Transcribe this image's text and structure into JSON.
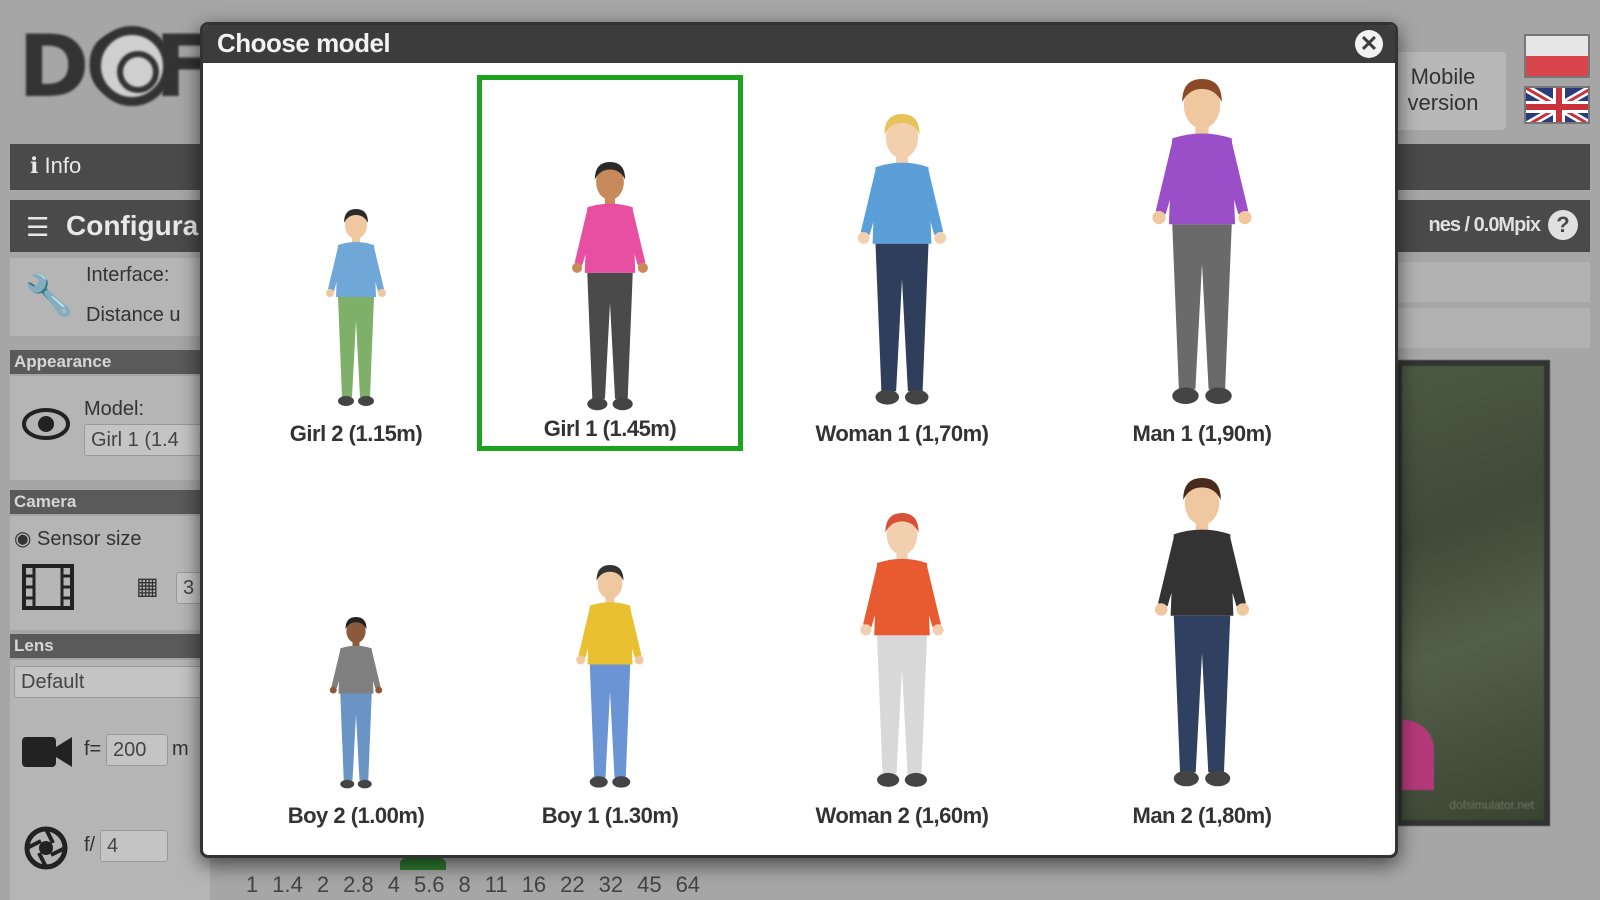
{
  "background": {
    "logo_text": "DOF",
    "info_label": "Info",
    "config_title": "Configura",
    "resolution_text": "nes / 0.0Mpix",
    "help_label": "?",
    "mobile_version": "Mobile version",
    "left_panel": {
      "interface_label": "Interface:",
      "distance_label": "Distance u",
      "appearance_header": "Appearance",
      "model_label": "Model:",
      "model_value": "Girl 1 (1.4",
      "camera_header": "Camera",
      "sensor_label": "Sensor size",
      "sensor_value": "3",
      "lens_header": "Lens",
      "lens_value": "Default",
      "focal_prefix": "f=",
      "focal_value": "200",
      "focal_unit": "m",
      "aperture_prefix": "f/",
      "aperture_value": "4"
    },
    "preview_watermark": "dofsimulator.net",
    "fstops": [
      "1",
      "1.4",
      "2",
      "2.8",
      "4",
      "5.6",
      "8",
      "11",
      "16",
      "22",
      "32",
      "45",
      "64"
    ]
  },
  "modal": {
    "title": "Choose model",
    "close_symbol": "✕",
    "models": [
      {
        "label": "Girl 2 (1.15m)",
        "height_m": 1.15,
        "selected": false,
        "shirt": "#6fa8d8",
        "bottom": "#7fb06a",
        "skin": "#f0c8a0",
        "hair": "#2a2a2a"
      },
      {
        "label": "Girl 1 (1.45m)",
        "height_m": 1.45,
        "selected": true,
        "shirt": "#e84fa3",
        "bottom": "#4a4a4a",
        "skin": "#c88a5a",
        "hair": "#2a2a2a"
      },
      {
        "label": "Woman 1 (1,70m)",
        "height_m": 1.7,
        "selected": false,
        "shirt": "#5b9fd8",
        "bottom": "#2f3e5a",
        "skin": "#f2cfae",
        "hair": "#e8c35a"
      },
      {
        "label": "Man 1 (1,90m)",
        "height_m": 1.9,
        "selected": false,
        "shirt": "#9a4ec8",
        "bottom": "#6a6a6a",
        "skin": "#f0c8a0",
        "hair": "#8a4a28"
      },
      {
        "label": "Boy 2 (1.00m)",
        "height_m": 1.0,
        "selected": false,
        "shirt": "#808080",
        "bottom": "#6a94c4",
        "skin": "#8a5a3a",
        "hair": "#222222"
      },
      {
        "label": "Boy 1 (1.30m)",
        "height_m": 1.3,
        "selected": false,
        "shirt": "#e8c030",
        "bottom": "#6a94d4",
        "skin": "#f0c8a0",
        "hair": "#333333"
      },
      {
        "label": "Woman 2 (1,60m)",
        "height_m": 1.6,
        "selected": false,
        "shirt": "#e85a30",
        "bottom": "#d8d8d8",
        "skin": "#f2cfae",
        "hair": "#d8503a"
      },
      {
        "label": "Man 2 (1,80m)",
        "height_m": 1.8,
        "selected": false,
        "shirt": "#333333",
        "bottom": "#2f4060",
        "skin": "#f0c8a0",
        "hair": "#4a2a1a"
      }
    ]
  }
}
